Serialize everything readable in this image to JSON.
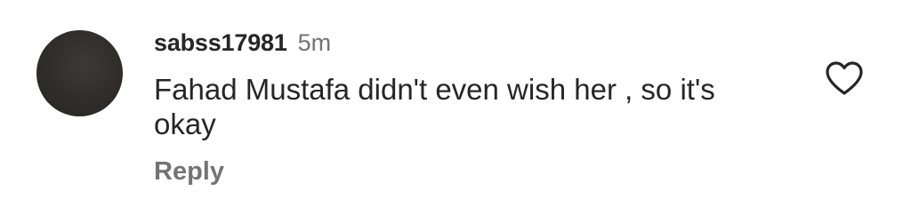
{
  "comment": {
    "username": "sabss17981",
    "time": "5m",
    "text": "Fahad Mustafa didn't even wish her , so it's okay",
    "reply_label": "Reply",
    "like_icon": "heart-outline-icon",
    "avatar_color": "#2e2d2a"
  },
  "colors": {
    "primary_text": "#262626",
    "secondary_text": "#737373",
    "background": "#ffffff"
  }
}
